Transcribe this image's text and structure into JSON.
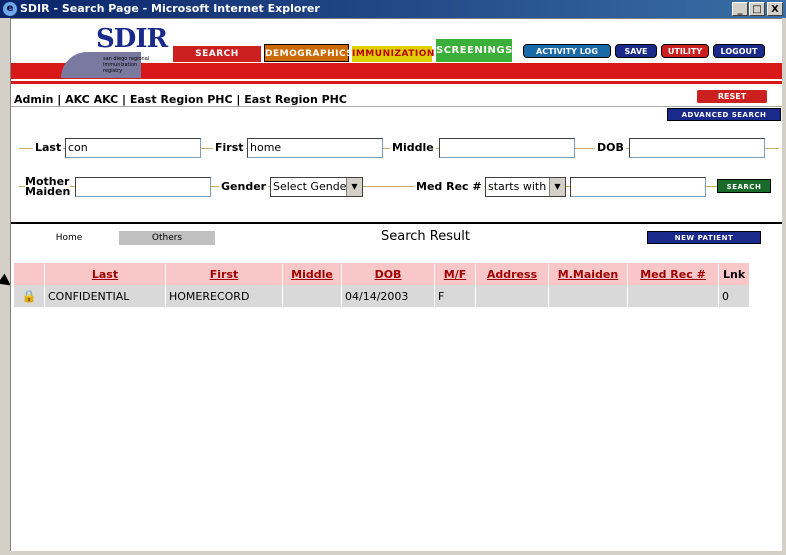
{
  "window": {
    "title": "SDIR - Search Page - Microsoft Internet Explorer",
    "buttons": [
      "_",
      "□",
      "X"
    ]
  },
  "logo": {
    "text": "SDIR",
    "tagline": "san diego regional immunization registry"
  },
  "nav": {
    "tabs": [
      "SEARCH",
      "DEMOGRAPHICS",
      "IMMUNIZATION",
      "SCREENINGS"
    ],
    "buttons": [
      "ACTIVITY LOG",
      "SAVE",
      "UTILITY",
      "LOGOUT"
    ]
  },
  "breadcrumb": "Admin | AKC AKC | East Region PHC | East Region PHC",
  "actions": {
    "reset": "RESET",
    "advanced_search": "ADVANCED SEARCH",
    "search": "SEARCH",
    "new_patient": "NEW PATIENT"
  },
  "form": {
    "last_label": "Last",
    "last_value": "con",
    "first_label": "First",
    "first_value": "home",
    "middle_label": "Middle",
    "middle_value": "",
    "dob_label": "DOB",
    "dob_value": "",
    "mother_maiden_label_1": "Mother",
    "mother_maiden_label_2": "Maiden",
    "mother_maiden_value": "",
    "gender_label": "Gender",
    "gender_value": "Select Gender",
    "medrec_label": "Med Rec #",
    "medrec_mode": "starts with",
    "medrec_value": ""
  },
  "results": {
    "tabs": [
      "Home",
      "Others"
    ],
    "title": "Search Result",
    "columns": [
      "Last",
      "First",
      "Middle",
      "DOB",
      "M/F",
      "Address",
      "M.Maiden",
      "Med Rec #",
      "Lnk"
    ],
    "rows": [
      {
        "lock": "🔒",
        "last": "CONFIDENTIAL",
        "first": "HOMERECORD",
        "middle": "",
        "dob": "04/14/2003",
        "mf": "F",
        "address": "",
        "maiden": "",
        "medrec": "",
        "lnk": "0"
      }
    ]
  },
  "colors": {
    "nav_red": "#d81818",
    "nav_blue": "#1a2a8a",
    "header_pink": "#f9c7c7",
    "row_gray": "#d9d9d9"
  }
}
